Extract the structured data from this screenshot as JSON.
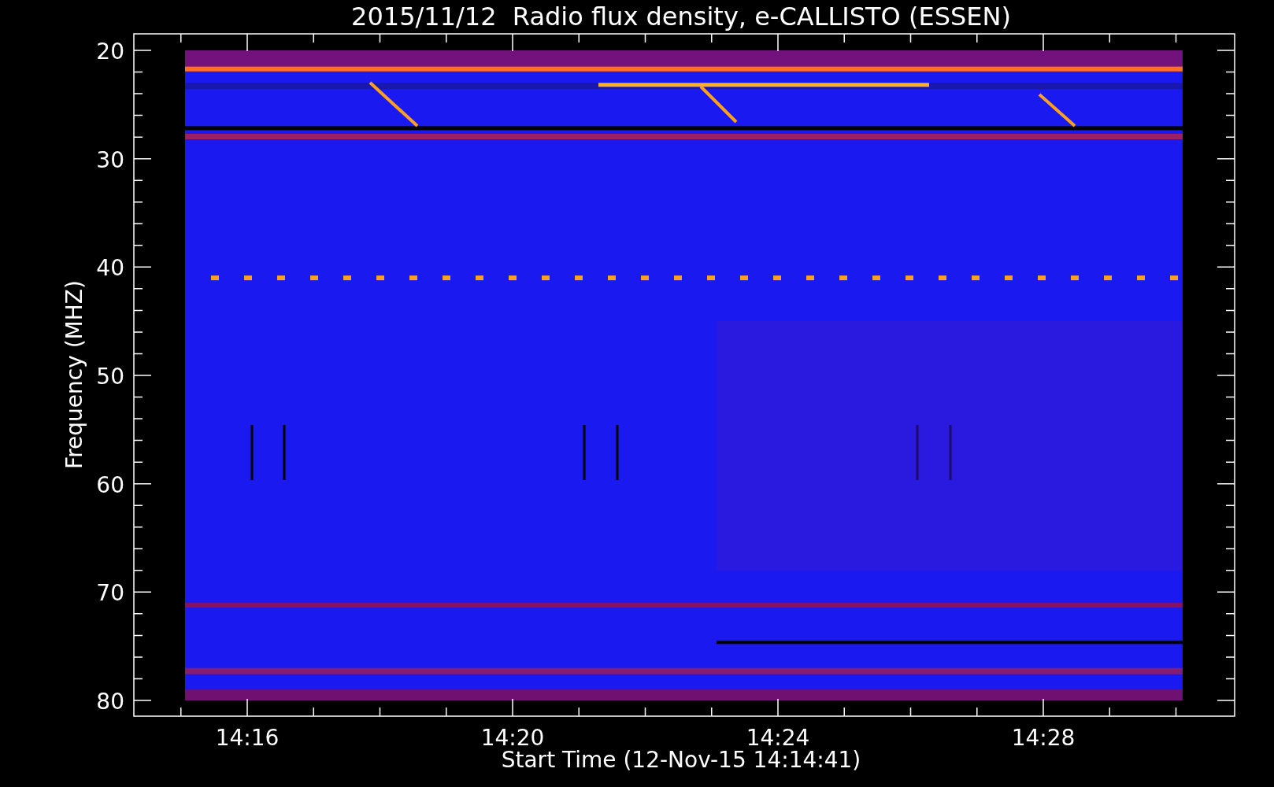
{
  "title": "2015/11/12  Radio flux density, e-CALLISTO (ESSEN)",
  "y_axis": {
    "label": "Frequency (MHZ)",
    "ticks": [
      "20",
      "30",
      "40",
      "50",
      "60",
      "70",
      "80"
    ]
  },
  "x_axis": {
    "label": "Start Time (12-Nov-15 14:14:41)",
    "ticks": [
      "14:16",
      "14:20",
      "14:24",
      "14:28"
    ]
  }
}
